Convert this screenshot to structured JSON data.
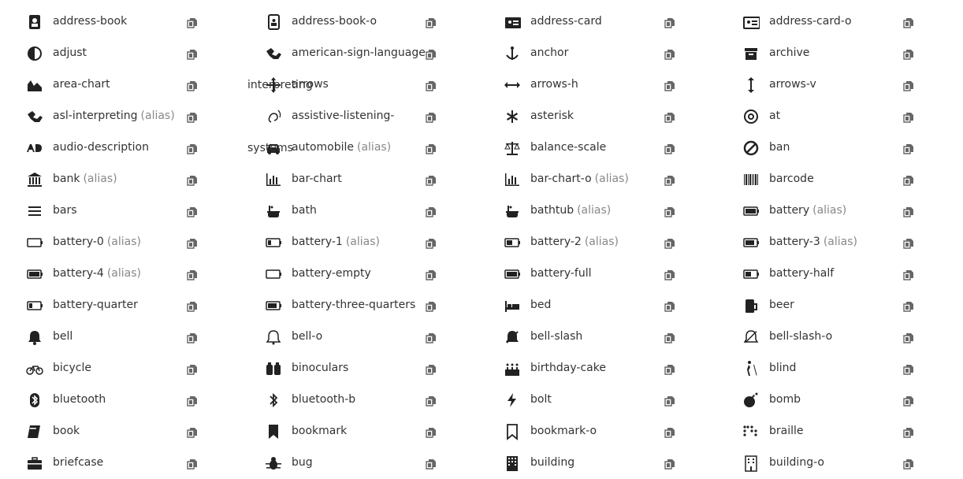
{
  "columns": [
    [
      {
        "name": "address-book",
        "alias": "",
        "icon": "address-book-icon"
      },
      {
        "name": "adjust",
        "alias": "",
        "icon": "adjust-icon"
      },
      {
        "name": "area-chart",
        "alias": "",
        "icon": "area-chart-icon"
      },
      {
        "name": "asl-interpreting",
        "alias": "(alias)",
        "icon": "asl-interpreting-icon"
      },
      {
        "name": "audio-description",
        "alias": "",
        "icon": "audio-description-icon"
      },
      {
        "name": "bank",
        "alias": "(alias)",
        "icon": "bank-icon"
      },
      {
        "name": "bars",
        "alias": "",
        "icon": "bars-icon"
      },
      {
        "name": "battery-0",
        "alias": "(alias)",
        "icon": "battery-0-icon"
      },
      {
        "name": "battery-4",
        "alias": "(alias)",
        "icon": "battery-4-icon"
      },
      {
        "name": "battery-quarter",
        "alias": "",
        "icon": "battery-quarter-icon"
      },
      {
        "name": "bell",
        "alias": "",
        "icon": "bell-icon"
      },
      {
        "name": "bicycle",
        "alias": "",
        "icon": "bicycle-icon"
      },
      {
        "name": "bluetooth",
        "alias": "",
        "icon": "bluetooth-icon"
      },
      {
        "name": "book",
        "alias": "",
        "icon": "book-icon"
      },
      {
        "name": "briefcase",
        "alias": "",
        "icon": "briefcase-icon"
      }
    ],
    [
      {
        "name": "address-book-o",
        "alias": "",
        "icon": "address-book-o-icon"
      },
      {
        "name": "american-sign-language-",
        "alias": "",
        "icon": "american-sign-language-interpreting-icon"
      },
      {
        "name": "arrows",
        "alias": "",
        "icon": "arrows-icon"
      },
      {
        "name": "assistive-listening-",
        "alias": "",
        "icon": "assistive-listening-systems-icon"
      },
      {
        "name": "automobile",
        "alias": "(alias)",
        "icon": "automobile-icon"
      },
      {
        "name": "bar-chart",
        "alias": "",
        "icon": "bar-chart-icon"
      },
      {
        "name": "bath",
        "alias": "",
        "icon": "bath-icon"
      },
      {
        "name": "battery-1",
        "alias": "(alias)",
        "icon": "battery-1-icon"
      },
      {
        "name": "battery-empty",
        "alias": "",
        "icon": "battery-empty-icon"
      },
      {
        "name": "battery-three-quarters",
        "alias": "",
        "icon": "battery-three-quarters-icon"
      },
      {
        "name": "bell-o",
        "alias": "",
        "icon": "bell-o-icon"
      },
      {
        "name": "binoculars",
        "alias": "",
        "icon": "binoculars-icon"
      },
      {
        "name": "bluetooth-b",
        "alias": "",
        "icon": "bluetooth-b-icon"
      },
      {
        "name": "bookmark",
        "alias": "",
        "icon": "bookmark-icon"
      },
      {
        "name": "bug",
        "alias": "",
        "icon": "bug-icon"
      }
    ],
    [
      {
        "name": "address-card",
        "alias": "",
        "icon": "address-card-icon"
      },
      {
        "name": "anchor",
        "alias": "",
        "icon": "anchor-icon"
      },
      {
        "name": "arrows-h",
        "alias": "",
        "icon": "arrows-h-icon"
      },
      {
        "name": "asterisk",
        "alias": "",
        "icon": "asterisk-icon"
      },
      {
        "name": "balance-scale",
        "alias": "",
        "icon": "balance-scale-icon"
      },
      {
        "name": "bar-chart-o",
        "alias": "(alias)",
        "icon": "bar-chart-o-icon"
      },
      {
        "name": "bathtub",
        "alias": "(alias)",
        "icon": "bathtub-icon"
      },
      {
        "name": "battery-2",
        "alias": "(alias)",
        "icon": "battery-2-icon"
      },
      {
        "name": "battery-full",
        "alias": "",
        "icon": "battery-full-icon"
      },
      {
        "name": "bed",
        "alias": "",
        "icon": "bed-icon"
      },
      {
        "name": "bell-slash",
        "alias": "",
        "icon": "bell-slash-icon"
      },
      {
        "name": "birthday-cake",
        "alias": "",
        "icon": "birthday-cake-icon"
      },
      {
        "name": "bolt",
        "alias": "",
        "icon": "bolt-icon"
      },
      {
        "name": "bookmark-o",
        "alias": "",
        "icon": "bookmark-o-icon"
      },
      {
        "name": "building",
        "alias": "",
        "icon": "building-icon"
      }
    ],
    [
      {
        "name": "address-card-o",
        "alias": "",
        "icon": "address-card-o-icon"
      },
      {
        "name": "archive",
        "alias": "",
        "icon": "archive-icon"
      },
      {
        "name": "arrows-v",
        "alias": "",
        "icon": "arrows-v-icon"
      },
      {
        "name": "at",
        "alias": "",
        "icon": "at-icon"
      },
      {
        "name": "ban",
        "alias": "",
        "icon": "ban-icon"
      },
      {
        "name": "barcode",
        "alias": "",
        "icon": "barcode-icon"
      },
      {
        "name": "battery",
        "alias": "(alias)",
        "icon": "battery-icon"
      },
      {
        "name": "battery-3",
        "alias": "(alias)",
        "icon": "battery-3-icon"
      },
      {
        "name": "battery-half",
        "alias": "",
        "icon": "battery-half-icon"
      },
      {
        "name": "beer",
        "alias": "",
        "icon": "beer-icon"
      },
      {
        "name": "bell-slash-o",
        "alias": "",
        "icon": "bell-slash-o-icon"
      },
      {
        "name": "blind",
        "alias": "",
        "icon": "blind-icon"
      },
      {
        "name": "bomb",
        "alias": "",
        "icon": "bomb-icon"
      },
      {
        "name": "braille",
        "alias": "",
        "icon": "braille-icon"
      },
      {
        "name": "building-o",
        "alias": "",
        "icon": "building-o-icon"
      }
    ]
  ],
  "overflow": {
    "interpreting": "interpreting",
    "systems": "systems"
  },
  "copy_icon": "copy-icon"
}
